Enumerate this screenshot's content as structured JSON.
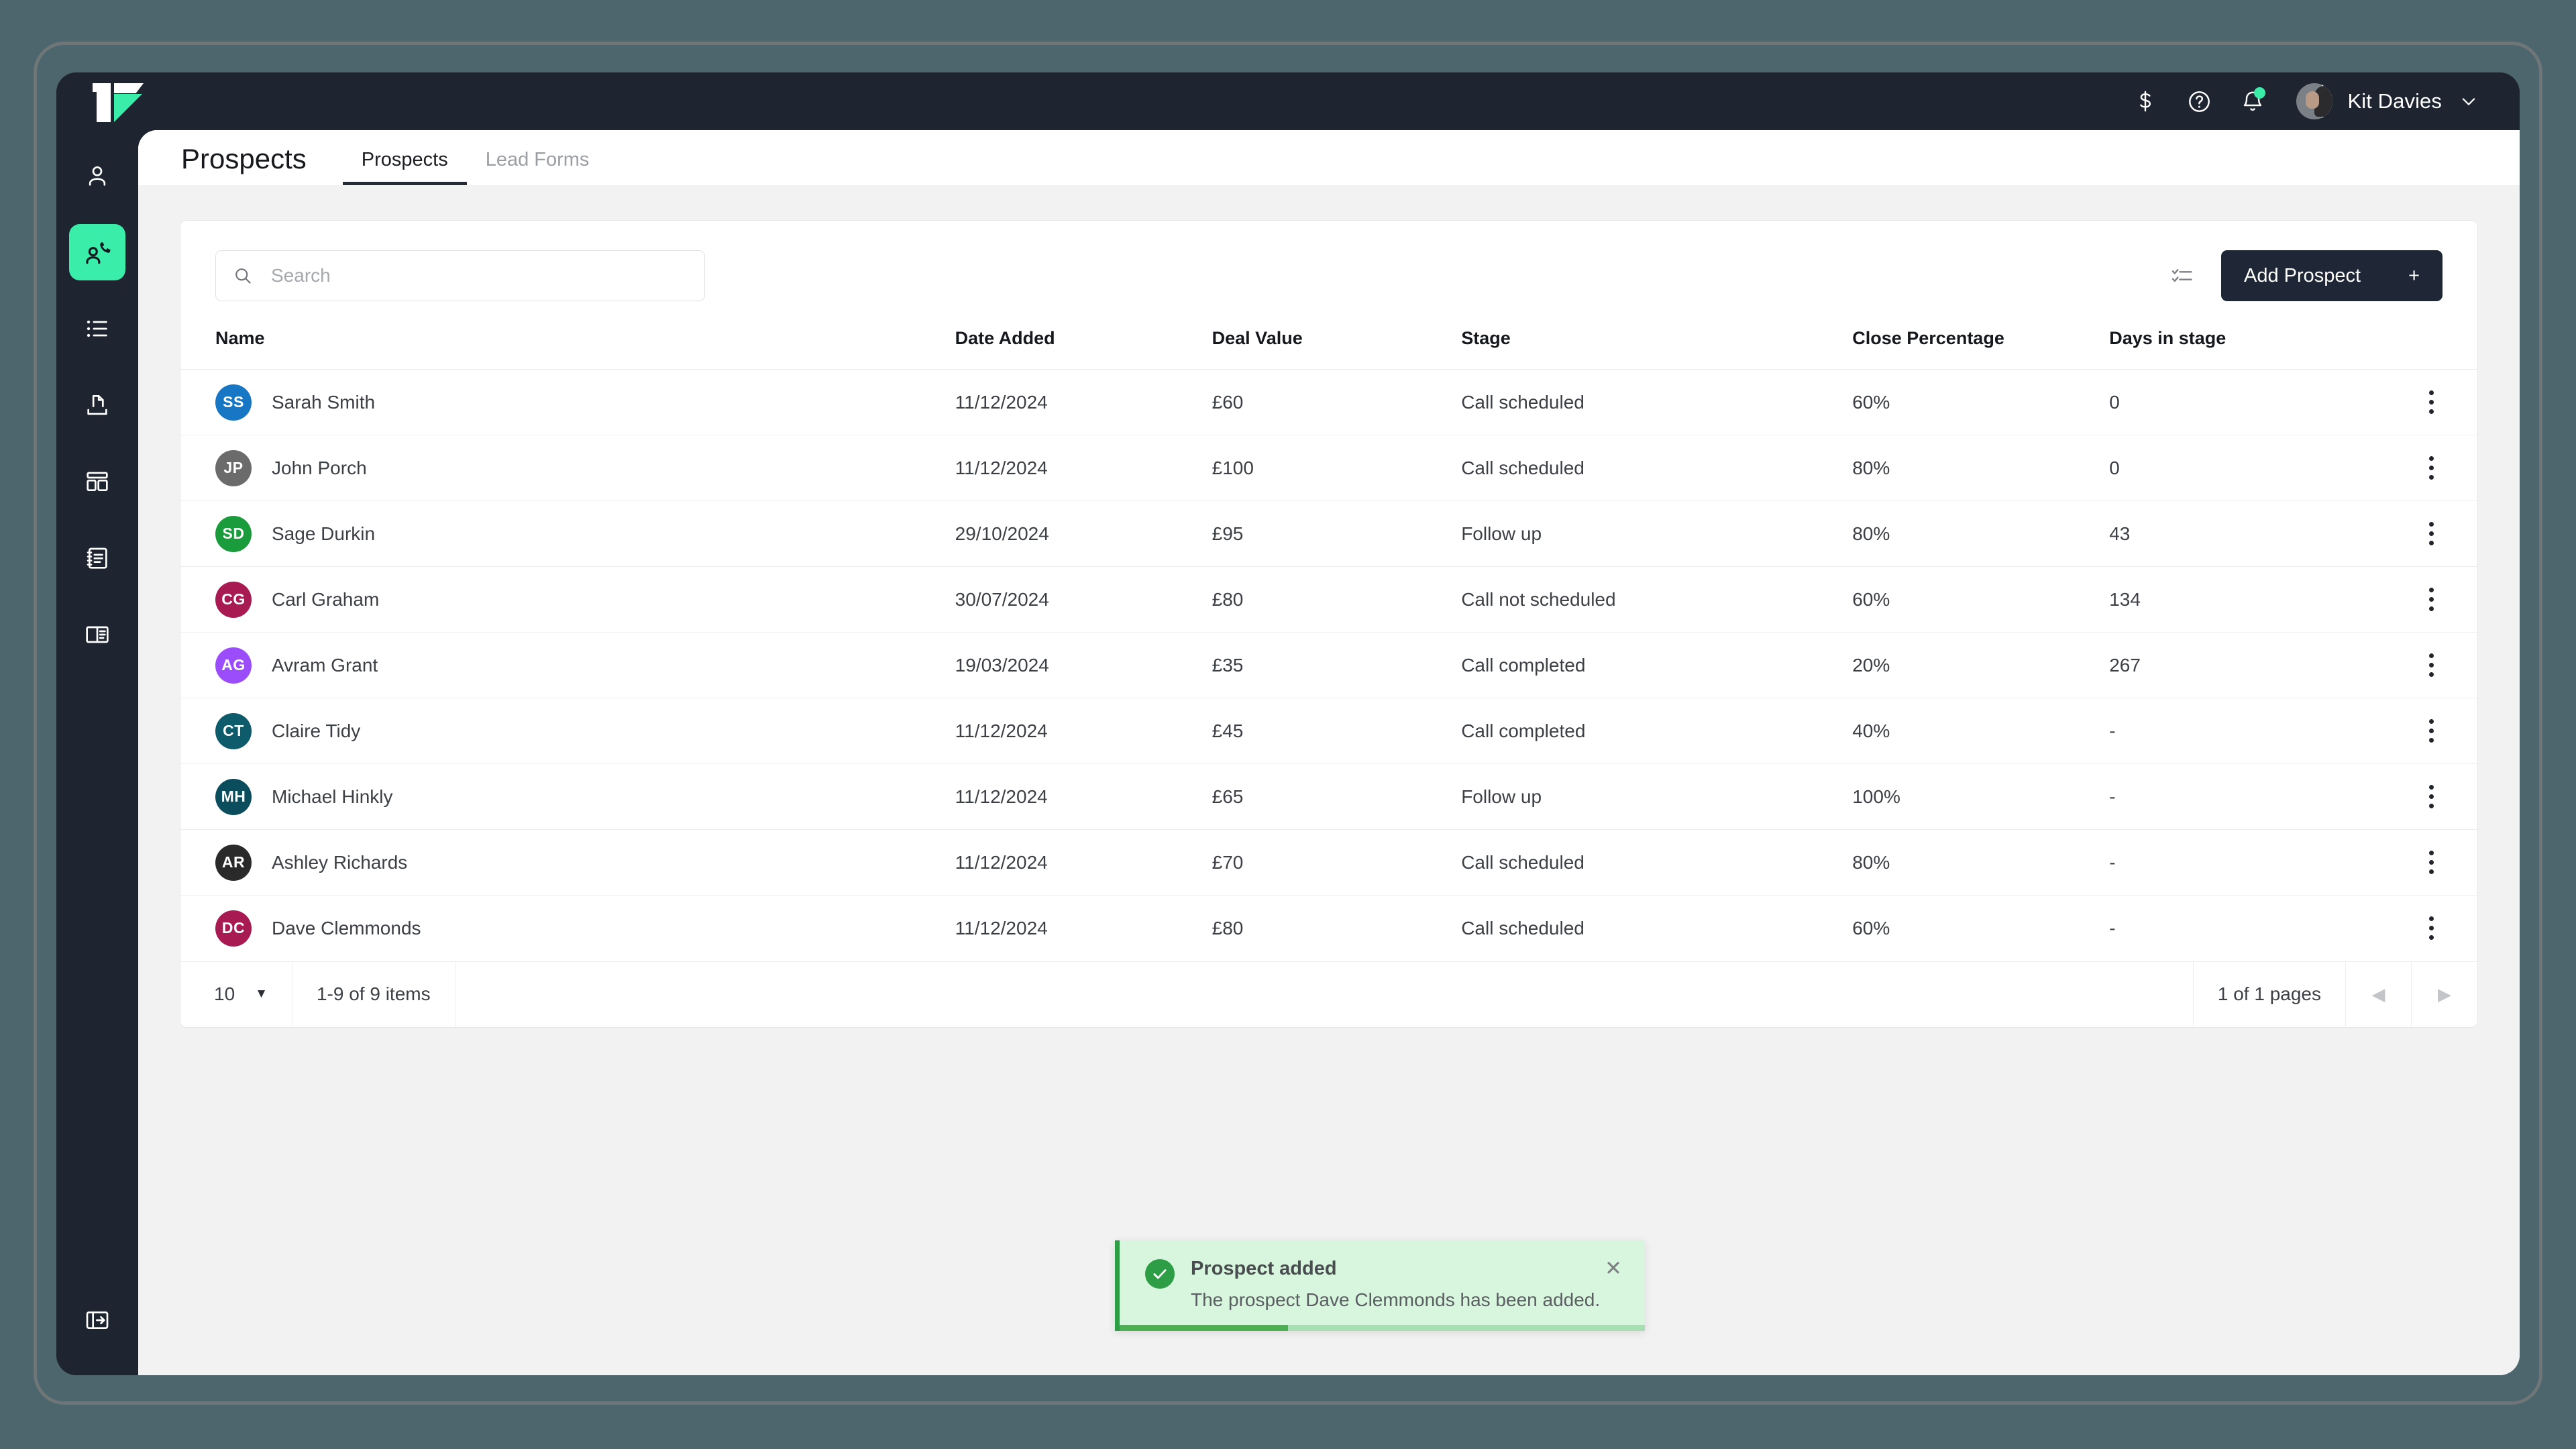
{
  "topbar": {
    "logo_name": "brand-logo",
    "icons": [
      {
        "name": "dollar-icon",
        "glyph": "$"
      },
      {
        "name": "help-icon",
        "glyph": "?"
      },
      {
        "name": "notifications-icon",
        "glyph": "bell"
      }
    ],
    "user_name": "Kit Davies",
    "accent_color": "#3aeda9",
    "bar_color": "#1e2430"
  },
  "sidebar": {
    "items": [
      {
        "name": "sidebar-item-contacts",
        "icon": "person-icon",
        "active": false
      },
      {
        "name": "sidebar-item-prospects",
        "icon": "person-phone-icon",
        "active": true
      },
      {
        "name": "sidebar-item-lists",
        "icon": "list-icon",
        "active": false
      },
      {
        "name": "sidebar-item-uploads",
        "icon": "upload-document-icon",
        "active": false
      },
      {
        "name": "sidebar-item-dashboard",
        "icon": "layout-icon",
        "active": false
      },
      {
        "name": "sidebar-item-notes",
        "icon": "notebook-icon",
        "active": false
      },
      {
        "name": "sidebar-item-library",
        "icon": "book-icon",
        "active": false
      }
    ],
    "bottom_item": {
      "name": "sidebar-expand-icon",
      "icon": "panel-expand-icon"
    }
  },
  "header": {
    "title": "Prospects",
    "tabs": [
      {
        "label": "Prospects",
        "active": true
      },
      {
        "label": "Lead Forms",
        "active": false
      }
    ]
  },
  "toolbar": {
    "search_placeholder": "Search",
    "search_value": "",
    "select_rows_icon": "checklist-icon",
    "add_label": "Add Prospect",
    "add_plus": "+"
  },
  "table": {
    "columns": [
      "Name",
      "Date Added",
      "Deal Value",
      "Stage",
      "Close Percentage",
      "Days in stage"
    ],
    "rows": [
      {
        "initials": "SS",
        "color": "#1877c4",
        "name": "Sarah Smith",
        "date": "11/12/2024",
        "value": "£60",
        "stage": "Call scheduled",
        "close": "60%",
        "days": "0"
      },
      {
        "initials": "JP",
        "color": "#6b6b6b",
        "name": "John Porch",
        "date": "11/12/2024",
        "value": "£100",
        "stage": "Call scheduled",
        "close": "80%",
        "days": "0"
      },
      {
        "initials": "SD",
        "color": "#1a9b3c",
        "name": "Sage Durkin",
        "date": "29/10/2024",
        "value": "£95",
        "stage": "Follow up",
        "close": "80%",
        "days": "43"
      },
      {
        "initials": "CG",
        "color": "#a81a52",
        "name": "Carl Graham",
        "date": "30/07/2024",
        "value": "£80",
        "stage": "Call not scheduled",
        "close": "60%",
        "days": "134"
      },
      {
        "initials": "AG",
        "color": "#9b4dfb",
        "name": "Avram Grant",
        "date": "19/03/2024",
        "value": "£35",
        "stage": "Call completed",
        "close": "20%",
        "days": "267"
      },
      {
        "initials": "CT",
        "color": "#0d5b6b",
        "name": "Claire Tidy",
        "date": "11/12/2024",
        "value": "£45",
        "stage": "Call completed",
        "close": "40%",
        "days": "-"
      },
      {
        "initials": "MH",
        "color": "#0b4d5c",
        "name": "Michael Hinkly",
        "date": "11/12/2024",
        "value": "£65",
        "stage": "Follow up",
        "close": "100%",
        "days": "-"
      },
      {
        "initials": "AR",
        "color": "#2a2a2a",
        "name": "Ashley Richards",
        "date": "11/12/2024",
        "value": "£70",
        "stage": "Call scheduled",
        "close": "80%",
        "days": "-"
      },
      {
        "initials": "DC",
        "color": "#a81a52",
        "name": "Dave Clemmonds",
        "date": "11/12/2024",
        "value": "£80",
        "stage": "Call scheduled",
        "close": "60%",
        "days": "-"
      }
    ],
    "row_menu_icon": "kebab-menu-icon"
  },
  "pagination": {
    "page_size": "10",
    "page_size_caret": "▼",
    "items_range": "1-9 of 9 items",
    "pages_label": "1 of 1 pages",
    "prev_glyph": "◀",
    "next_glyph": "▶"
  },
  "toast": {
    "title": "Prospect added",
    "message": "The prospect Dave Clemmonds has been added.",
    "close_glyph": "✕",
    "accent_color": "#2e9e46",
    "background_color": "#d8f6dd",
    "progress_percent": 32
  }
}
